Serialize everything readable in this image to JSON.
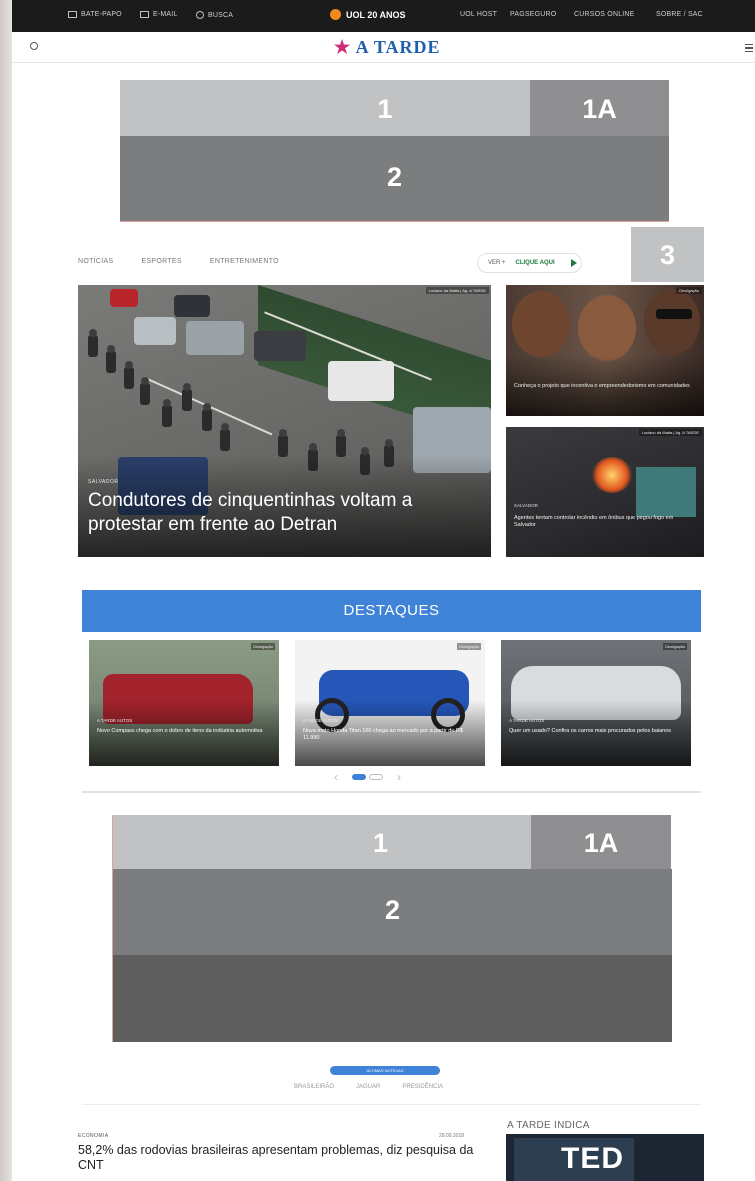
{
  "topbar": {
    "items": [
      "BATE-PAPO",
      "E-MAIL",
      "BUSCA"
    ],
    "brand": "UOL 20 ANOS",
    "links": [
      "UOL HOST",
      "PAGSEGURO",
      "CURSOS ONLINE",
      "SOBRE / SAC"
    ]
  },
  "header": {
    "logo_mark": "★",
    "logo_text": "A TARDE"
  },
  "ads_top": {
    "label_1": "1",
    "label_1a": "1A",
    "label_2": "2",
    "label_3": "3"
  },
  "tabs": [
    "NOTÍCIAS",
    "ESPORTES",
    "ENTRETENIMENTO"
  ],
  "more": {
    "label": "VER +",
    "highlight": "CLIQUE AQUI"
  },
  "hero": {
    "credit": "Luciano da Matta | Ag. A TARDE",
    "kicker": "SALVADOR",
    "title": "Condutores de cinquentinhas voltam a protestar em frente ao Detran"
  },
  "side_stories": [
    {
      "kicker": "",
      "title": "Conheça o projeto que incentiva o empreendedorismo em comunidades",
      "credit": "Divulgação"
    },
    {
      "kicker": "SALVADOR",
      "title": "Agentes tentam controlar incêndio em ônibus que pegou fogo em Salvador",
      "credit": "Luciano da Matta | Ag. A TARDE"
    }
  ],
  "destaques": {
    "title": "DESTAQUES",
    "cards": [
      {
        "kicker": "A TARDE AUTOS",
        "title": "Novo Compass chega com o dobro de itens da indústria automotiva",
        "badge": "Divulgação"
      },
      {
        "kicker": "A TARDE AUTOS",
        "title": "Nova moto Honda Titan 160 chega ao mercado por a partir de R$ 11.990",
        "badge": "Divulgação"
      },
      {
        "kicker": "A TARDE AUTOS",
        "title": "Quer um usado? Confira os carros mais procurados pelos baianos",
        "badge": "Divulgação"
      }
    ],
    "prev": "‹",
    "next": "›"
  },
  "ads_mid": {
    "label_1": "1",
    "label_1a": "1A",
    "label_2": "2"
  },
  "bottom": {
    "pill": "ÚLTIMAS NOTÍCIAS",
    "tabs": [
      "BRASILEIRÃO",
      "JAGUAR",
      "PRESIDÊNCIA"
    ],
    "news_kicker": "ECONOMIA",
    "news_date": "29.09.2018",
    "news_title": "58,2% das rodovias brasileiras apresentam problemas, diz pesquisa da CNT",
    "indica_label": "A TARDE INDICA",
    "indica_img_text": "TED"
  }
}
